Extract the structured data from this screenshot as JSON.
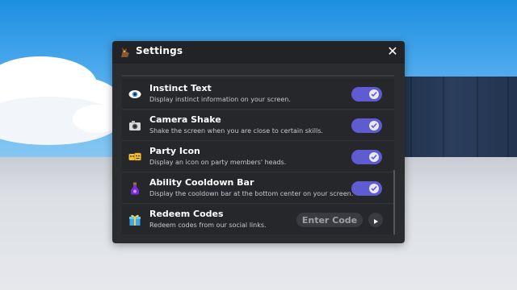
{
  "panel": {
    "title": "Settings",
    "header_icon": "creature-icon",
    "close_icon": "close-icon",
    "close_glyph": "✕"
  },
  "settings": [
    {
      "title": "Instinct Text",
      "description": "Display instinct information on your screen.",
      "icon": "eye-icon",
      "enabled": true
    },
    {
      "title": "Camera Shake",
      "description": "Shake the screen when you are close to certain skills.",
      "icon": "camera-icon",
      "enabled": true
    },
    {
      "title": "Party Icon",
      "description": "Display an icon on party members' heads.",
      "icon": "party-faces-icon",
      "enabled": true
    },
    {
      "title": "Ability Cooldown Bar",
      "description": "Display the cooldown bar at the bottom center on your screen.",
      "icon": "potion-icon",
      "enabled": true
    }
  ],
  "redeem": {
    "title": "Redeem Codes",
    "description": "Redeem codes from our social links.",
    "icon": "gift-icon",
    "input_placeholder": "Enter Code",
    "input_value": "",
    "submit_icon": "play-arrow-icon"
  },
  "colors": {
    "toggle_on": "#5f5cd1",
    "panel_bg": "#2b2c30",
    "header_bg": "#222326"
  }
}
